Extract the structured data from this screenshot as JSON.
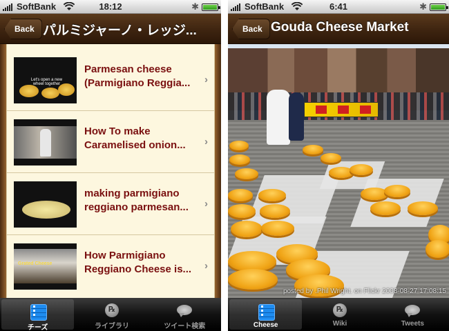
{
  "left": {
    "status": {
      "carrier": "SoftBank",
      "time": "18:12",
      "bluetooth": "✱"
    },
    "navbar": {
      "back_label": "Back",
      "title": "パルミジャーノ・レッジ..."
    },
    "videos": [
      {
        "title": "Parmesan cheese (Parmigiano Reggia...",
        "thumb_caption": "Let's open a new wheel together"
      },
      {
        "title": "How To make Caramelised onion..."
      },
      {
        "title": "making parmigiano reggiano parmesan..."
      },
      {
        "title": "How Parmigiano Reggiano Cheese is...",
        "thumb_caption": "Grated Cheese"
      }
    ],
    "chevron": "›",
    "tabs": [
      {
        "label": "チーズ",
        "icon": "list-icon",
        "active": true
      },
      {
        "label": "ライブラリ",
        "icon": "globe-icon",
        "active": false
      },
      {
        "label": "ツイート検索",
        "icon": "speech-bubble-icon",
        "active": false
      }
    ]
  },
  "right": {
    "status": {
      "carrier": "SoftBank",
      "time": "6:41",
      "bluetooth": "✱"
    },
    "navbar": {
      "back_label": "Back",
      "title": "Gouda Cheese Market"
    },
    "photo_caption": "posted by .Phil Wright. on Flickr 2008-08-27 17:08:15",
    "tabs": [
      {
        "label": "Cheese",
        "icon": "list-icon",
        "active": true
      },
      {
        "label": "Wiki",
        "icon": "globe-icon",
        "active": false
      },
      {
        "label": "Tweets",
        "icon": "speech-bubble-icon",
        "active": false
      }
    ]
  },
  "colors": {
    "nav_brown": "#3e2410",
    "row_title_red": "#7a1010",
    "list_bg": "#fdf7df"
  }
}
